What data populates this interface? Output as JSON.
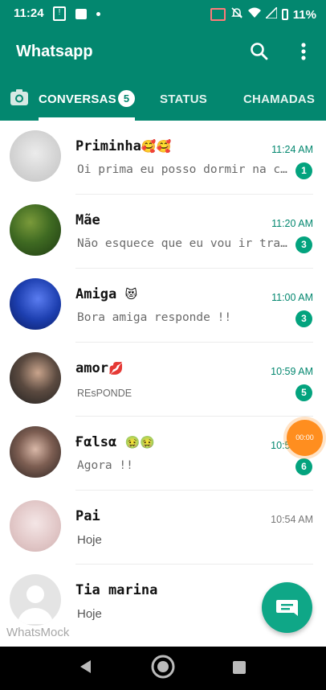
{
  "status_bar": {
    "time": "11:24",
    "battery": "11%"
  },
  "app_bar": {
    "title": "Whatsapp"
  },
  "tabs": [
    {
      "label": "CONVERSAS",
      "badge": "5",
      "active": true
    },
    {
      "label": "STATUS"
    },
    {
      "label": "CHAMADAS"
    }
  ],
  "chats": [
    {
      "name": "Priminha",
      "emoji": "🥰🥰",
      "time": "11:24 AM",
      "message": "Oi prima eu posso dormir na casa de vocês hoje",
      "unread": "1",
      "avatar_color": "#d9d9d9"
    },
    {
      "name": "Mãe",
      "emoji": "",
      "time": "11:20 AM",
      "message": "Não esquece que eu vou ir trabalhar",
      "unread": "3",
      "avatar_color": "#2f5f1f"
    },
    {
      "name": "Amiga",
      "emoji": "😻",
      "time": "11:00 AM",
      "message": "Bora amiga responde !!",
      "unread": "3",
      "avatar_color": "#1b3ea8"
    },
    {
      "name": "amor",
      "emoji": "💋",
      "time": "10:59 AM",
      "message": "REsPONDE",
      "unread": "5",
      "avatar_color": "#3a3a3a"
    },
    {
      "name": "Ғαlѕα",
      "emoji": "🤢🤢",
      "time": "10:57 AM",
      "message": "Agora !!",
      "unread": "6",
      "avatar_color": "#5a4a44"
    },
    {
      "name": "Pai",
      "emoji": "",
      "time": "10:54 AM",
      "message": "Hoje",
      "unread": "",
      "avatar_color": "#e9d6d6"
    },
    {
      "name": "Tia marina",
      "emoji": "",
      "time": "",
      "message": "Hoje",
      "unread": "",
      "avatar_color": "#dcdcdc"
    }
  ],
  "recording_bubble": {
    "label": "00:00"
  },
  "watermark": "WhatsMock",
  "colors": {
    "primary": "#03876f",
    "accent": "#03a37e",
    "fab": "#0fa787"
  }
}
